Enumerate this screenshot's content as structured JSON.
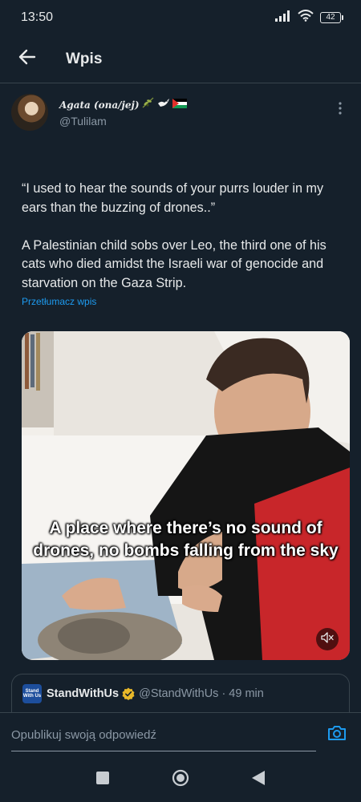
{
  "status_bar": {
    "time": "13:50",
    "battery": "42",
    "icons": [
      "signal-icon",
      "wifi-icon",
      "battery-icon"
    ]
  },
  "header": {
    "title": "Wpis",
    "back_icon": "arrow-left-icon"
  },
  "tweet": {
    "author": {
      "display_name": "Agata (ona/jej)",
      "emoji": [
        "olive-branch",
        "dove",
        "palestine-flag"
      ],
      "handle": "@Tulilam"
    },
    "text": "“I used to hear the sounds of your purrs louder in my ears than the buzzing of drones..”\n\nA Palestinian child sobs over Leo, the third one of his cats who died amidst the Israeli war of genocide and starvation on the Gaza Strip.",
    "translate_label": "Przetłumacz wpis",
    "video": {
      "caption": "A place where there’s no sound of drones, no bombs falling from the sky",
      "muted": true
    },
    "quote": {
      "avatar_text": "Stand With Us",
      "name": "StandWithUs",
      "verified": true,
      "handle": "@StandWithUs",
      "separator": "·",
      "time": "49 min"
    }
  },
  "reply": {
    "placeholder": "Opublikuj swoją odpowiedź"
  },
  "colors": {
    "background": "#15202b",
    "text": "#e7e9ea",
    "secondary": "#8b98a5",
    "accent": "#1d9bf0",
    "border": "#38444d"
  }
}
